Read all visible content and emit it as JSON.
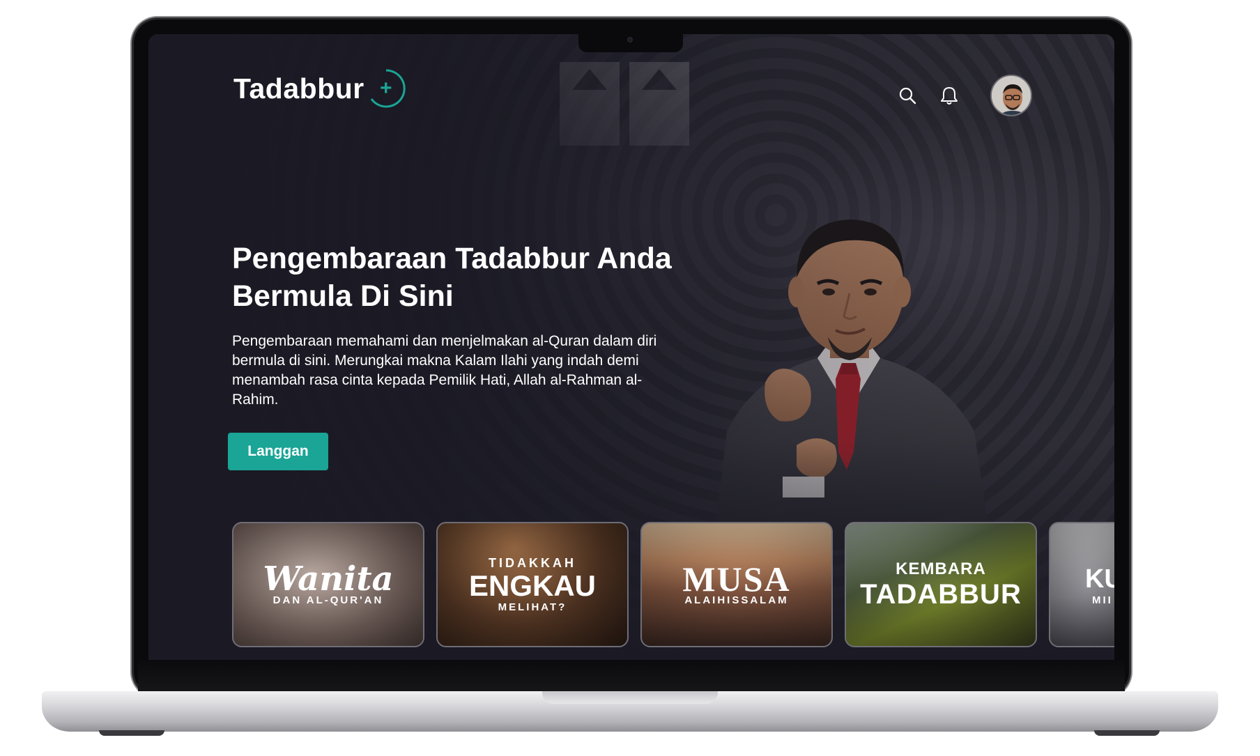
{
  "app": {
    "logo_text": "Tadabbur",
    "logo_symbol": "+",
    "accent_color": "#1aa596"
  },
  "nav": {
    "icons": [
      "search-icon",
      "bell-icon",
      "avatar"
    ]
  },
  "hero": {
    "title_line1": "Pengembaraan Tadabbur Anda",
    "title_line2": "Bermula Di Sini",
    "description": "Pengembaraan memahami dan menjelmakan al-Quran dalam diri bermula di sini. Merungkai makna Kalam Ilahi yang indah demi menambah rasa cinta kepada Pemilik Hati, Allah al-Rahman al-Rahim.",
    "cta_label": "Langgan"
  },
  "cards": [
    {
      "eyebrow": "",
      "main": "Wanita",
      "sub": "DAN AL-QUR'AN"
    },
    {
      "eyebrow": "TIDAKKAH",
      "main": "ENGKAU",
      "sub": "MELIHAT?"
    },
    {
      "eyebrow": "",
      "main": "MUSA",
      "sub": "ALAIHISSALAM"
    },
    {
      "eyebrow": "KEMBARA",
      "main": "TADABBUR",
      "sub": ""
    },
    {
      "eyebrow": "",
      "main": "KU",
      "sub": "MII"
    }
  ]
}
